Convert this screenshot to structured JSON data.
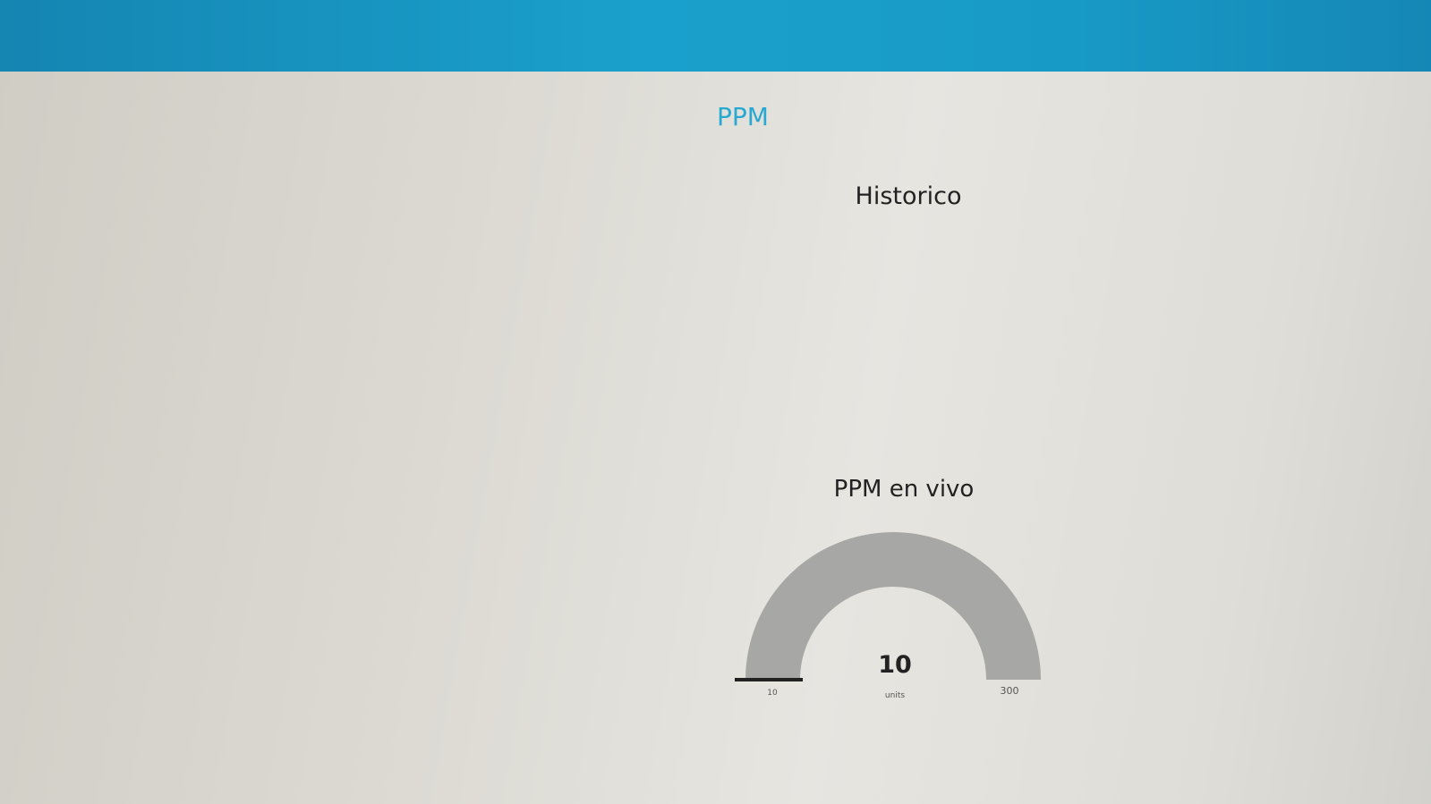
{
  "header": {
    "color": "#1a9bc8"
  },
  "page": {
    "title": "PPM",
    "title_color": "#29a9d2"
  },
  "historico": {
    "title": "Historico"
  },
  "live_gauge": {
    "title": "PPM en vivo",
    "value": "10",
    "units": "units",
    "min": "10",
    "max": "300",
    "fraction": 0.0,
    "arc_color": "#a7a7a5",
    "needle_color": "#222222"
  }
}
